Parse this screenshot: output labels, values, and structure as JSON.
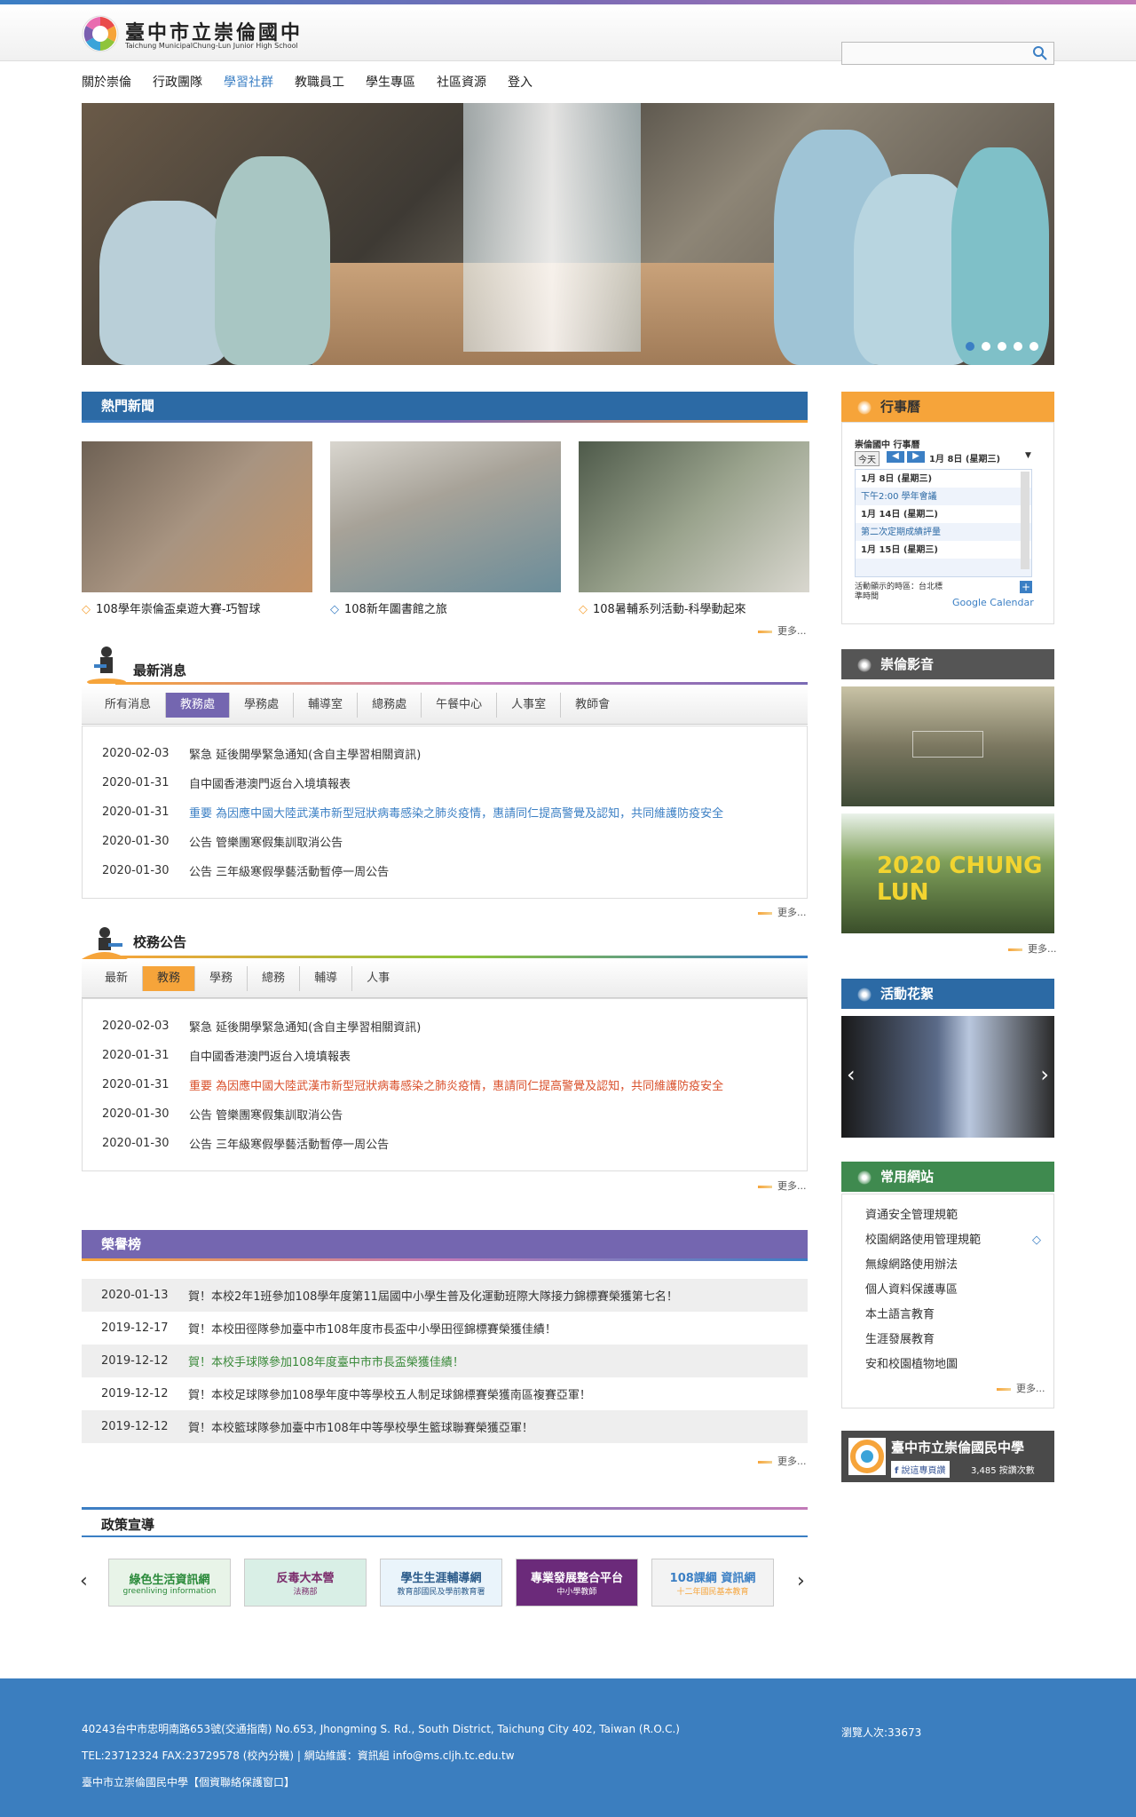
{
  "site": {
    "title": "臺中市立崇倫國中",
    "subtitle": "Taichung MunicipalChung-Lun Junior High School",
    "search_placeholder": ""
  },
  "nav": [
    "關於崇倫",
    "行政團隊",
    "學習社群",
    "教職員工",
    "學生專區",
    "社區資源",
    "登入"
  ],
  "hot_news": {
    "title": "熱門新聞",
    "items": [
      "108學年崇倫盃桌遊大賽-巧智球",
      "108新年圖書館之旅",
      "108暑輔系列活動-科學動起來"
    ],
    "more": "更多..."
  },
  "latest_news": {
    "title": "最新消息",
    "tabs": [
      "所有消息",
      "教務處",
      "學務處",
      "輔導室",
      "總務處",
      "午餐中心",
      "人事室",
      "教師會"
    ],
    "rows": [
      {
        "date": "2020-02-03",
        "text": "緊急 延後開學緊急通知(含自主學習相關資訊)"
      },
      {
        "date": "2020-01-31",
        "text": "自中國香港澳門返台入境填報表"
      },
      {
        "date": "2020-01-31",
        "text": "重要 為因應中國大陸武漢市新型冠狀病毒感染之肺炎疫情，惠請同仁提高警覺及認知，共同維護防疫安全"
      },
      {
        "date": "2020-01-30",
        "text": "公告 管樂團寒假集訓取消公告"
      },
      {
        "date": "2020-01-30",
        "text": "公告 三年級寒假學藝活動暫停一周公告"
      }
    ],
    "more": "更多..."
  },
  "school_notices": {
    "title": "校務公告",
    "tabs": [
      "最新",
      "教務",
      "學務",
      "總務",
      "輔導",
      "人事"
    ],
    "rows": [
      {
        "date": "2020-02-03",
        "text": "緊急 延後開學緊急通知(含自主學習相關資訊)"
      },
      {
        "date": "2020-01-31",
        "text": "自中國香港澳門返台入境填報表"
      },
      {
        "date": "2020-01-31",
        "text": "重要 為因應中國大陸武漢市新型冠狀病毒感染之肺炎疫情，惠請同仁提高警覺及認知，共同維護防疫安全"
      },
      {
        "date": "2020-01-30",
        "text": "公告 管樂團寒假集訓取消公告"
      },
      {
        "date": "2020-01-30",
        "text": "公告 三年級寒假學藝活動暫停一周公告"
      }
    ],
    "more": "更多..."
  },
  "honor": {
    "title": "榮譽榜",
    "rows": [
      {
        "date": "2020-01-13",
        "text": "賀！本校2年1班參加108學年度第11屆國中小學生普及化運動班際大隊接力錦標賽榮獲第七名！"
      },
      {
        "date": "2019-12-17",
        "text": "賀！本校田徑隊參加臺中市108年度市長盃中小學田徑錦標賽榮獲佳績！"
      },
      {
        "date": "2019-12-12",
        "text": "賀！本校手球隊參加108年度臺中市市長盃榮獲佳績！"
      },
      {
        "date": "2019-12-12",
        "text": "賀！本校足球隊參加108學年度中等學校五人制足球錦標賽榮獲南區複賽亞軍！"
      },
      {
        "date": "2019-12-12",
        "text": "賀！本校籃球隊參加臺中市108年中等學校學生籃球聯賽榮獲亞軍！"
      }
    ],
    "more": "更多..."
  },
  "policy": {
    "title": "政策宣導",
    "logos": [
      {
        "line1": "綠色生活資訊網",
        "line2": "greenliving information"
      },
      {
        "line1": "反毒大本營",
        "line2": "法務部"
      },
      {
        "line1": "學生生涯輔導網",
        "line2": "教育部國民及學前教育署"
      },
      {
        "line1": "專業發展整合平台",
        "line2": "中小學教師"
      },
      {
        "line1": "108課綱 資訊網",
        "line2": "十二年國民基本教育"
      }
    ]
  },
  "sidebar": {
    "calendar": {
      "title": "行事曆",
      "cal_name": "崇倫國中 行事曆",
      "today": "今天",
      "date_label": "1月 8日 (星期三)",
      "entries": [
        {
          "label": "1月 8日 (星期三)",
          "type": "day"
        },
        {
          "label": "下午2:00   學年會議",
          "type": "event"
        },
        {
          "label": "1月 14日 (星期二)",
          "type": "day"
        },
        {
          "label": "第二次定期成績評量",
          "type": "event"
        },
        {
          "label": "1月 15日 (星期三)",
          "type": "day"
        }
      ],
      "tz_note": "活動顯示的時區：台北標準時間",
      "google": "Google Calendar"
    },
    "video": {
      "title": "崇倫影音",
      "more": "更多...",
      "clip2_text": "2020 CHUNG LUN"
    },
    "gallery": {
      "title": "活動花絮"
    },
    "links": {
      "title": "常用網站",
      "items": [
        "資通安全管理規範",
        "校園網路使用管理規範",
        "無線網路使用辦法",
        "個人資料保護專區",
        "本土語言教育",
        "生涯發展教育",
        "安和校園植物地圖"
      ],
      "more": "更多..."
    },
    "fb": {
      "name": "臺中市立崇倫國民中學",
      "button": "說這專頁讚",
      "likes": "3,485 按讚次數"
    }
  },
  "footer": {
    "address": "40243台中市忠明南路653號(交通指南)    No.653, Jhongming S. Rd., South District, Taichung City 402, Taiwan (R.O.C.)",
    "contact": "TEL:23712324 FAX:23729578 (校內分機)  |  網站維護：資訊組 info@ms.cljh.tc.edu.tw",
    "privacy": "臺中市立崇倫國民中學【個資聯絡保護窗口】",
    "visits": "瀏覽人次:33673"
  },
  "colors": {
    "blue": "#2c6aa5",
    "orange": "#f6a43a",
    "purple": "#7466b0",
    "green": "#3f8a4f",
    "gray": "#555555"
  }
}
